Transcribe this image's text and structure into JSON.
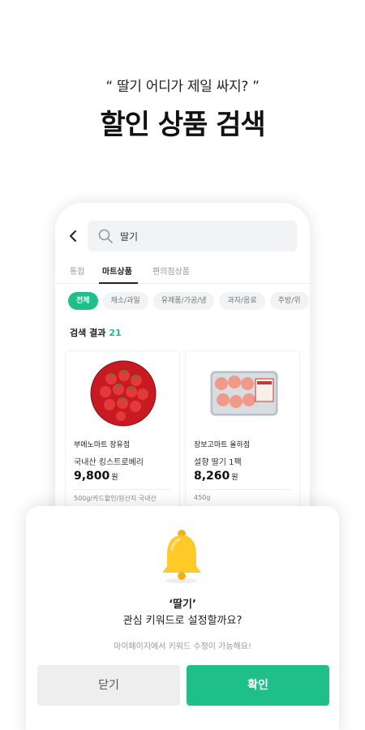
{
  "headline": {
    "subtitle": "“ 딸기 어디가 제일 싸지? ”",
    "title": "할인 상품 검색"
  },
  "search": {
    "query": "딸기"
  },
  "tabs": [
    {
      "label": "통합"
    },
    {
      "label": "마트상품"
    },
    {
      "label": "편의점상품"
    }
  ],
  "chips": [
    {
      "label": "전체"
    },
    {
      "label": "채소/과일"
    },
    {
      "label": "유제품/가공/냉"
    },
    {
      "label": "과자/음료"
    },
    {
      "label": "주방/위"
    }
  ],
  "results": {
    "label": "검색 결과",
    "count": "21"
  },
  "products": [
    {
      "store": "부에노마트 장유점",
      "name": "국내산 킹스트로베리",
      "price": "9,800",
      "currency": "원",
      "meta": "500g/카드할인/원산지 국내산"
    },
    {
      "store": "장보고마트 올하점",
      "name": "설향 딸기 1팩",
      "price": "8,260",
      "currency": "원",
      "meta": "450g"
    }
  ],
  "sheet": {
    "keyword": "‘딸기’",
    "question": "관심 키워드로 설정할까요?",
    "note": "마이페이지에서 키워드 수정이 가능해요!",
    "close_label": "닫기",
    "confirm_label": "확인"
  },
  "colors": {
    "accent": "#1fbf8a",
    "bell": "#ffc928"
  }
}
